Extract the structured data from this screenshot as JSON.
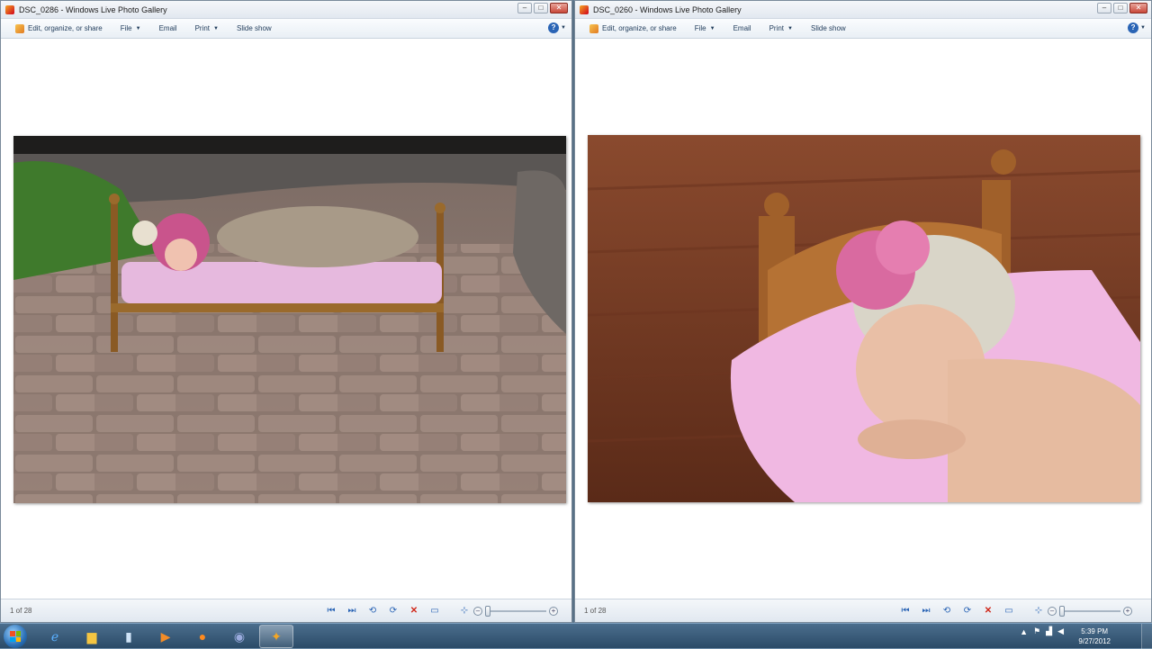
{
  "windows": [
    {
      "title": "DSC_0286 - Windows Live Photo Gallery",
      "toolbar": {
        "edit": "Edit, organize, or share",
        "file": "File",
        "email": "Email",
        "print": "Print",
        "slideshow": "Slide show"
      },
      "status": {
        "counter": "1 of 28"
      }
    },
    {
      "title": "DSC_0260 - Windows Live Photo Gallery",
      "toolbar": {
        "edit": "Edit, organize, or share",
        "file": "File",
        "email": "Email",
        "print": "Print",
        "slideshow": "Slide show"
      },
      "status": {
        "counter": "1 of 28"
      }
    }
  ],
  "taskbar": {
    "icons": [
      "ie-icon",
      "explorer-icon",
      "doc-icon",
      "media-player-icon",
      "firefox-icon",
      "webcam-icon",
      "photo-gallery-icon"
    ],
    "clock": {
      "time": "5:39 PM",
      "date": "9/27/2012"
    }
  },
  "colors": {
    "accent": "#2a64b5",
    "delete": "#d0281a",
    "taskbar": "#2b4b68"
  }
}
